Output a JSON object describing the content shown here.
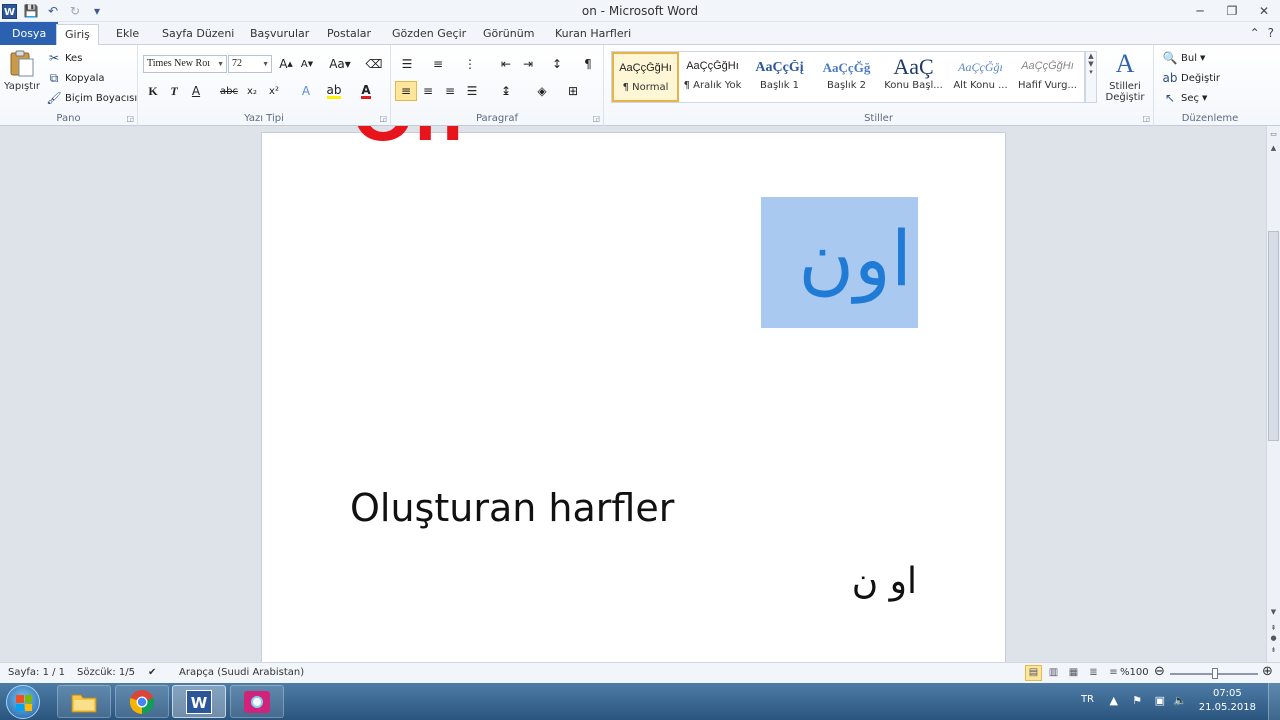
{
  "window": {
    "title": "on  -  Microsoft Word",
    "minimize_glyph": "─",
    "maximize_glyph": "❐",
    "close_glyph": "✕"
  },
  "tabs": {
    "items": [
      "Dosya",
      "Giriş",
      "Ekle",
      "Sayfa Düzeni",
      "Başvurular",
      "Postalar",
      "Gözden Geçir",
      "Görünüm",
      "Kuran Harfleri"
    ],
    "active": "Giriş"
  },
  "ribbon": {
    "clipboard": {
      "group_label": "Pano",
      "paste_label": "Yapıştır",
      "cut_label": "Kes",
      "copy_label": "Kopyala",
      "format_painter_label": "Biçim Boyacısı"
    },
    "font": {
      "group_label": "Yazı Tipi",
      "font_name": "Times New Roı",
      "font_size": "72",
      "bold": "K",
      "italic": "T",
      "underline": "A",
      "strike": "abc",
      "subscript": "x₂",
      "superscript": "x²"
    },
    "paragraph": {
      "group_label": "Paragraf"
    },
    "styles": {
      "group_label": "Stiller",
      "change_styles_label": "Stilleri Değiştir",
      "items": [
        {
          "preview": "AaÇçĞğHı",
          "name": "¶ Normal"
        },
        {
          "preview": "AaÇçĞğHı",
          "name": "¶ Aralık Yok"
        },
        {
          "preview": "AaÇçĞį",
          "name": "Başlık 1"
        },
        {
          "preview": "AaÇçĞğ",
          "name": "Başlık 2"
        },
        {
          "preview": "AaÇ",
          "name": "Konu Başl..."
        },
        {
          "preview": "AaÇçĞğı",
          "name": "Alt Konu ..."
        },
        {
          "preview": "AaÇçĞğHı",
          "name": "Hafif Vurg..."
        }
      ]
    },
    "editing": {
      "group_label": "Düzenleme",
      "find_label": "Bul",
      "replace_label": "Değiştir",
      "select_label": "Seç"
    }
  },
  "document": {
    "red_text": "On",
    "selected_arabic": "اون",
    "heading": "Oluşturan harfler",
    "letters": "او ن"
  },
  "status": {
    "page": "Sayfa: 1 / 1",
    "words": "Sözcük: 1/5",
    "language": "Arapça (Suudi Arabistan)",
    "zoom": "%100"
  },
  "taskbar": {
    "tray_lang": "TR",
    "time": "07:05",
    "date": "21.05.2018"
  },
  "colors": {
    "file_tab": "#2b61b0",
    "selection": "#a9c9f0",
    "red_text": "#e8141c",
    "arabic_blue": "#1f7bd6"
  }
}
